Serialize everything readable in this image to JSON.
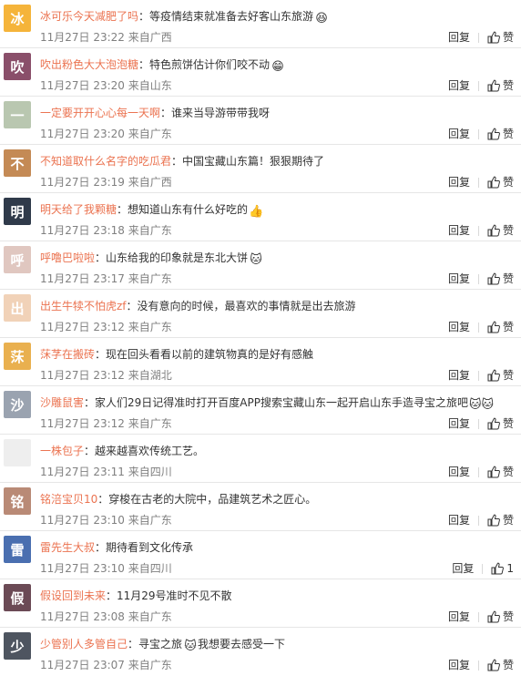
{
  "comments": [
    {
      "user": "冰可乐今天减肥了吗",
      "text": "：等疫情结束就准备去好客山东旅游",
      "emoji": "😆",
      "time": "11月27日 23:22",
      "from": "来自广西",
      "reply": "回复",
      "like": "赞",
      "avatar_color": "#f5b43a",
      "avatar_glyph": "冰"
    },
    {
      "user": "吹出粉色大大泡泡糖",
      "text": "：特色煎饼估计你们咬不动",
      "emoji": "😁",
      "time": "11月27日 23:20",
      "from": "来自山东",
      "reply": "回复",
      "like": "赞",
      "avatar_color": "#8a4f6a",
      "avatar_glyph": "吹"
    },
    {
      "user": "一定要开开心心每一天啊",
      "text": "：谁来当导游带带我呀",
      "emoji": "",
      "time": "11月27日 23:20",
      "from": "来自广东",
      "reply": "回复",
      "like": "赞",
      "avatar_color": "#b9c7b0",
      "avatar_glyph": "一"
    },
    {
      "user": "不知道取什么名字的吃瓜君",
      "text": "：中国宝藏山东篇！狠狠期待了",
      "emoji": "",
      "time": "11月27日 23:19",
      "from": "来自广西",
      "reply": "回复",
      "like": "赞",
      "avatar_color": "#c48a55",
      "avatar_glyph": "不"
    },
    {
      "user": "明天给了我颗糖",
      "text": "：想知道山东有什么好吃的",
      "emoji": "👍",
      "time": "11月27日 23:18",
      "from": "来自广东",
      "reply": "回复",
      "like": "赞",
      "avatar_color": "#2f3a4a",
      "avatar_glyph": "明"
    },
    {
      "user": "呼噜巴啦啦",
      "text": "：山东给我的印象就是东北大饼",
      "emoji": "🐱",
      "time": "11月27日 23:17",
      "from": "来自广东",
      "reply": "回复",
      "like": "赞",
      "avatar_color": "#e0c7c0",
      "avatar_glyph": "呼"
    },
    {
      "user": "出生牛犊不怕虎zf",
      "text": "：没有意向的时候，最喜欢的事情就是出去旅游",
      "emoji": "",
      "time": "11月27日 23:12",
      "from": "来自广东",
      "reply": "回复",
      "like": "赞",
      "avatar_color": "#f1d2b8",
      "avatar_glyph": "出"
    },
    {
      "user": "莯芓在搬砖",
      "text": "：现在回头看看以前的建筑物真的是好有感触",
      "emoji": "",
      "time": "11月27日 23:12",
      "from": "来自湖北",
      "reply": "回复",
      "like": "赞",
      "avatar_color": "#e9b04f",
      "avatar_glyph": "莯"
    },
    {
      "user": "沙雕鼠害",
      "text": "：家人们29日记得准时打开百度APP搜索宝藏山东一起开启山东手造寻宝之旅吧",
      "emoji": "🐱🐱",
      "time": "11月27日 23:12",
      "from": "来自广东",
      "reply": "回复",
      "like": "赞",
      "avatar_color": "#9aa3b0",
      "avatar_glyph": "沙"
    },
    {
      "user": "一株包子",
      "text": "：越来越喜欢传统工艺。",
      "emoji": "",
      "time": "11月27日 23:11",
      "from": "来自四川",
      "reply": "回复",
      "like": "赞",
      "avatar_color": "#eeeeee",
      "avatar_glyph": ""
    },
    {
      "user": "铭涪宝贝10",
      "text": "：穿梭在古老的大院中，品建筑艺术之匠心。",
      "emoji": "",
      "time": "11月27日 23:10",
      "from": "来自广东",
      "reply": "回复",
      "like": "赞",
      "avatar_color": "#b98a76",
      "avatar_glyph": "铭"
    },
    {
      "user": "雷先生大叔",
      "text": "：期待看到文化传承",
      "emoji": "",
      "time": "11月27日 23:10",
      "from": "来自四川",
      "reply": "回复",
      "like": "1",
      "avatar_color": "#4a6fb0",
      "avatar_glyph": "雷"
    },
    {
      "user": "假设回到未来",
      "text": "：11月29号准时不见不散",
      "emoji": "",
      "time": "11月27日 23:08",
      "from": "来自广东",
      "reply": "回复",
      "like": "赞",
      "avatar_color": "#6b4a55",
      "avatar_glyph": "假"
    },
    {
      "user": "少管别人多管自己",
      "text": "：寻宝之旅",
      "emoji": "🐱",
      "text2": "我想要去感受一下",
      "time": "11月27日 23:07",
      "from": "来自广东",
      "reply": "回复",
      "like": "赞",
      "avatar_color": "#4e5560",
      "avatar_glyph": "少"
    }
  ],
  "colors": {
    "username": "#eb7350",
    "meta": "#808080",
    "divider": "#e6e6e6"
  }
}
